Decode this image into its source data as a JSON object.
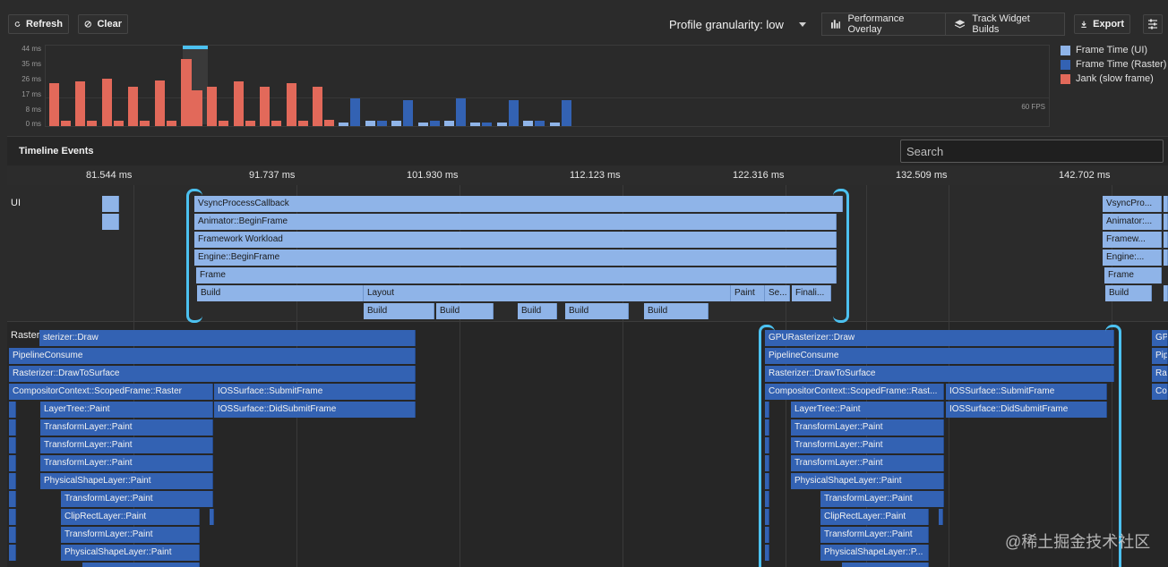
{
  "toolbar": {
    "refresh_label": "Refresh",
    "clear_label": "Clear",
    "granularity_label": "Profile granularity: low",
    "performance_overlay_label": "Performance Overlay",
    "track_widget_builds_label": "Track Widget Builds",
    "export_label": "Export"
  },
  "frame_chart": {
    "y_ticks": [
      "44 ms",
      "35 ms",
      "26 ms",
      "17 ms",
      "8 ms",
      "0 ms"
    ],
    "fps_label": "60 FPS",
    "legend": [
      {
        "label": "Frame Time (UI)",
        "color": "#8fb4e8"
      },
      {
        "label": "Frame Time (Raster)",
        "color": "#3362b3"
      },
      {
        "label": "Jank (slow frame)",
        "color": "#e2695a"
      }
    ]
  },
  "chart_data": {
    "type": "bar",
    "title": "",
    "xlabel": "",
    "ylabel": "",
    "ylim": [
      0,
      48
    ],
    "series": [
      {
        "name": "Frame Time (UI)",
        "values": [
          4,
          3,
          3,
          4,
          6,
          28,
          5,
          4,
          3,
          5,
          3,
          2,
          3,
          3,
          2,
          3,
          2,
          2,
          3,
          2
        ]
      },
      {
        "name": "Frame Time (Raster)",
        "values": [
          2,
          1,
          1,
          2,
          2,
          22,
          2,
          1,
          1,
          2,
          4,
          17,
          3,
          16,
          3,
          17,
          2,
          16,
          3,
          16
        ]
      },
      {
        "name": "Jank (slow frame)",
        "values": [
          26,
          27,
          29,
          24,
          28,
          41,
          24,
          27,
          24,
          26,
          24,
          0,
          0,
          0,
          0,
          0,
          0,
          0,
          0,
          0
        ]
      }
    ]
  },
  "timeline": {
    "title": "Timeline Events",
    "search_placeholder": "Search",
    "ruler": [
      "81.544 ms",
      "91.737 ms",
      "101.930 ms",
      "112.123 ms",
      "122.316 ms",
      "132.509 ms",
      "142.702 ms"
    ],
    "ui_lane_label": "UI",
    "raster_lane_label": "Raster",
    "ui_events": {
      "vsync": "VsyncProcessCallback",
      "animator": "Animator::BeginFrame",
      "framework": "Framework Workload",
      "engine": "Engine::BeginFrame",
      "frame": "Frame",
      "build": "Build",
      "layout": "Layout",
      "paint": "Paint",
      "se": "Se...",
      "finali": "Finali...",
      "vsync_short": "VsyncPro...",
      "animator_short": "Animator:...",
      "framework_short": "Framew...",
      "engine_short": "Engine:...",
      "build_child": "Build"
    },
    "raster_events": {
      "gpu_draw_cut": "sterizer::Draw",
      "pipeline": "PipelineConsume",
      "draw_to_surface": "Rasterizer::DrawToSurface",
      "compositor": "CompositorContext::ScopedFrame::Raster",
      "compositor_short": "CompositorContext::ScopedFrame::Rast...",
      "ios_submit": "IOSSurface::SubmitFrame",
      "ios_did_submit": "IOSSurface::DidSubmitFrame",
      "layer_tree": "LayerTree::Paint",
      "transform": "TransformLayer::Paint",
      "physical": "PhysicalShapeLayer::Paint",
      "physical_short": "PhysicalShapeLayer::P...",
      "cliprect": "ClipRectLayer::Paint",
      "gpu_draw": "GPURasterizer::Draw",
      "gpu_cut": "GPU",
      "pip_cut": "Pip",
      "ra_cut": "Ra",
      "co_cut": "Co"
    }
  },
  "watermark": "@稀土掘金技术社区"
}
